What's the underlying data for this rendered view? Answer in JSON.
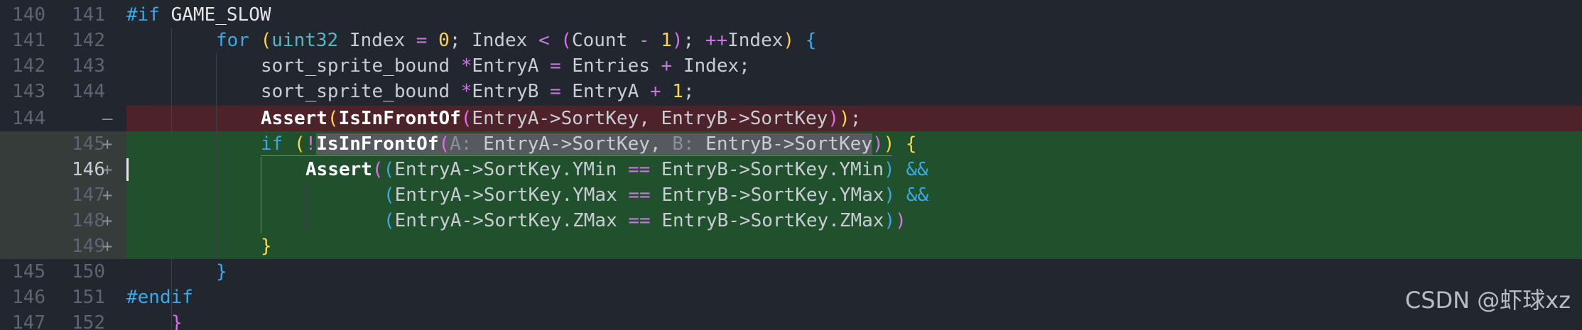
{
  "lines": [
    {
      "old": "140",
      "new": "141",
      "marker": "",
      "kind": "normal"
    },
    {
      "old": "141",
      "new": "142",
      "marker": "",
      "kind": "normal"
    },
    {
      "old": "142",
      "new": "143",
      "marker": "",
      "kind": "normal"
    },
    {
      "old": "143",
      "new": "144",
      "marker": "",
      "kind": "normal"
    },
    {
      "old": "144",
      "new": "",
      "marker": "—",
      "kind": "removed"
    },
    {
      "old": "",
      "new": "145",
      "marker": "+",
      "kind": "added"
    },
    {
      "old": "",
      "new": "146",
      "marker": "+",
      "kind": "added"
    },
    {
      "old": "",
      "new": "147",
      "marker": "+",
      "kind": "added"
    },
    {
      "old": "",
      "new": "148",
      "marker": "+",
      "kind": "added"
    },
    {
      "old": "",
      "new": "149",
      "marker": "+",
      "kind": "added"
    },
    {
      "old": "145",
      "new": "150",
      "marker": "",
      "kind": "normal"
    },
    {
      "old": "146",
      "new": "151",
      "marker": "",
      "kind": "normal"
    },
    {
      "old": "147",
      "new": "152",
      "marker": "",
      "kind": "normal"
    }
  ],
  "code": {
    "l0": {
      "pp": "#if",
      "name": "GAME_SLOW"
    },
    "l1": {
      "for": "for",
      "paren_open": "(",
      "type": "uint32",
      "a": " Index ",
      "eq": "=",
      "b": " ",
      "zero": "0",
      "c": "; Index ",
      "lt": "<",
      "d": " ",
      "p2o": "(",
      "e": "Count ",
      "minus": "-",
      "f": " ",
      "one": "1",
      "p2c": ")",
      "g": "; ",
      "inc": "++",
      "h": "Index",
      "paren_close": ")",
      "brace": " {"
    },
    "l2": {
      "a": "sort_sprite_bound ",
      "star": "*",
      "b": "EntryA ",
      "eq": "=",
      "c": " Entries ",
      "plus": "+",
      "d": " Index;"
    },
    "l3": {
      "a": "sort_sprite_bound ",
      "star": "*",
      "b": "EntryB ",
      "eq": "=",
      "c": " EntryA ",
      "plus": "+",
      "d": " ",
      "one": "1",
      "e": ";"
    },
    "l4": {
      "fn1": "Assert",
      "p1": "(",
      "fn2": "IsInFrontOf",
      "p2": "(",
      "args": "EntryA->SortKey, EntryB->SortKey",
      "p2c": ")",
      "p1c": ")",
      "semi": ";"
    },
    "l5": {
      "if": "if",
      "sp": " ",
      "po": "(",
      "bang": "!",
      "fn": "IsInFrontOf",
      "pp": "(",
      "ha": "A:",
      "a": " EntryA->SortKey, ",
      "hb": "B:",
      "b": " EntryB->SortKey",
      "ppc": ")",
      "pc": ")",
      "brace": " {"
    },
    "l6": {
      "fn": "Assert",
      "po": "(",
      "pi": "(",
      "a": "EntryA->SortKey.YMin ",
      "eq": "==",
      "b": " EntryB->SortKey.YMin",
      "pic": ")",
      "and": " &&"
    },
    "l7": {
      "pi": "(",
      "a": "EntryA->SortKey.YMax ",
      "eq": "==",
      "b": " EntryB->SortKey.YMax",
      "pic": ")",
      "and": " &&"
    },
    "l8": {
      "pi": "(",
      "a": "EntryA->SortKey.ZMax ",
      "eq": "==",
      "b": " EntryB->SortKey.ZMax",
      "pic": ")",
      "po": ")"
    },
    "l9": {
      "brace": "}"
    },
    "l10": {
      "brace": "}"
    },
    "l11": {
      "pp": "#endif"
    },
    "l12": {
      "brace": "}"
    }
  },
  "watermark": "CSDN @虾球xz",
  "colors": {
    "background": "#22262e",
    "removed": "#4d2329",
    "added": "#20502c",
    "keyword": "#3ba9e5",
    "type": "#56b6c2",
    "number": "#ffd54a"
  }
}
